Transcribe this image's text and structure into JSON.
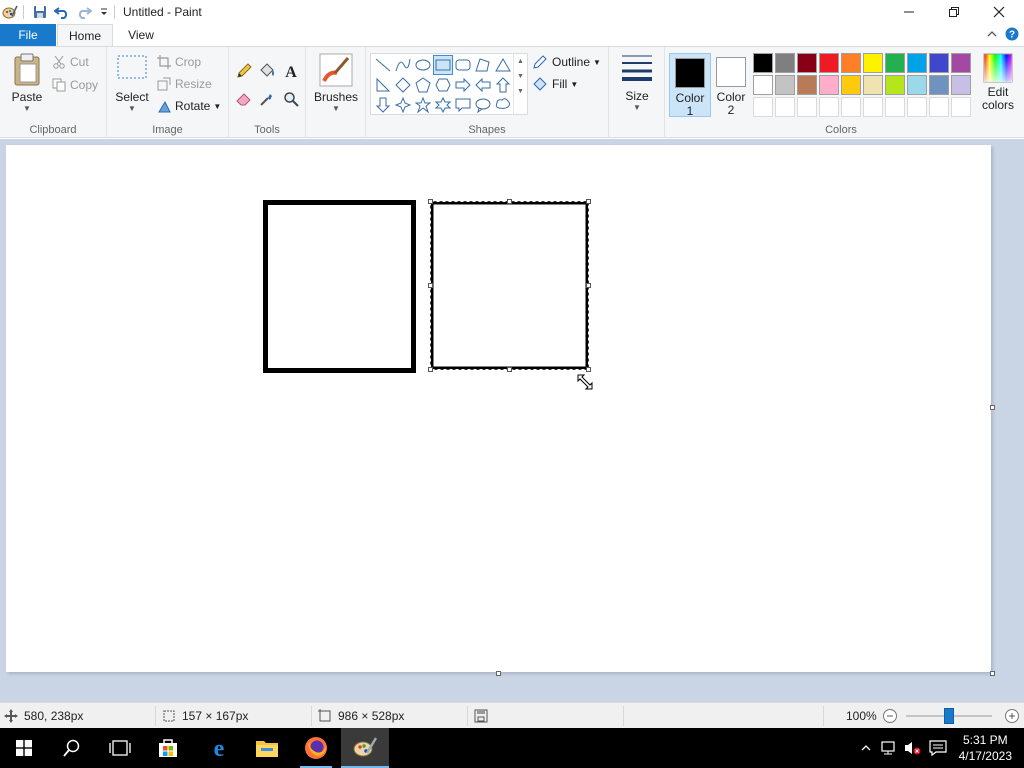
{
  "window": {
    "title": "Untitled - Paint",
    "app_icon": "paint-app-icon"
  },
  "quick_access": [
    "save-icon",
    "undo-icon",
    "redo-icon",
    "customize-dropdown-icon"
  ],
  "tabs": {
    "file": "File",
    "home": "Home",
    "view": "View"
  },
  "ribbon": {
    "clipboard": {
      "label": "Clipboard",
      "paste": "Paste",
      "cut": "Cut",
      "copy": "Copy"
    },
    "image": {
      "label": "Image",
      "select": "Select",
      "crop": "Crop",
      "resize": "Resize",
      "rotate": "Rotate"
    },
    "tools": {
      "label": "Tools"
    },
    "brushes": {
      "label": "Brushes"
    },
    "shapes": {
      "label": "Shapes",
      "outline": "Outline",
      "fill": "Fill",
      "selected_shape": "rectangle"
    },
    "size": {
      "label": "Size"
    },
    "colors": {
      "label": "Colors",
      "color1_line1": "Color",
      "color1_line2": "1",
      "color2_line1": "Color",
      "color2_line2": "2",
      "edit_line1": "Edit",
      "edit_line2": "colors",
      "color1_value": "#000000",
      "color2_value": "#ffffff",
      "palette_row1": [
        "#000000",
        "#7f7f7f",
        "#880015",
        "#ed1c24",
        "#ff7f27",
        "#fff200",
        "#22b14c",
        "#00a2e8",
        "#3f48cc",
        "#a349a4"
      ],
      "palette_row2": [
        "#ffffff",
        "#c3c3c3",
        "#b97a57",
        "#ffaec9",
        "#ffc90e",
        "#efe4b0",
        "#b5e61d",
        "#99d9ea",
        "#7092be",
        "#c8bfe7"
      ],
      "palette_row3_empty": 10
    }
  },
  "status": {
    "cursor_pos": "580, 238px",
    "selection_size": "157 × 167px",
    "canvas_size": "986 × 528px",
    "zoom": "100%",
    "zoom_level": 0.5
  },
  "taskbar": {
    "time": "5:31 PM",
    "date": "4/17/2023",
    "apps": [
      "start-button",
      "search-button",
      "task-view-button",
      "store-app",
      "edge-app",
      "file-explorer-app",
      "firefox-app",
      "paint-app"
    ]
  }
}
